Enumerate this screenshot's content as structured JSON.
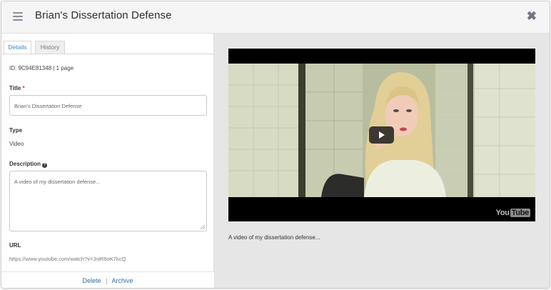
{
  "header": {
    "title": "Brian's Dissertation Defense",
    "menu_icon": "hamburger-icon",
    "close_icon": "close-icon",
    "close_glyph": "✖"
  },
  "tabs": [
    {
      "label": "Details",
      "active": true
    },
    {
      "label": "History",
      "active": false
    }
  ],
  "details": {
    "id_line": "ID: 9C94E81348 | 1 page",
    "title_label": "Title",
    "required_mark": "*",
    "title_value": "Brian's Dissertation Defense",
    "type_label": "Type",
    "type_value": "Video",
    "description_label": "Description",
    "help_icon": "help-icon",
    "help_glyph": "?",
    "description_value": "A video of my dissertation defense...",
    "url_label": "URL",
    "url_value": "https://www.youtube.com/watch?v=JniR6oK7kcQ"
  },
  "footer": {
    "delete_label": "Delete",
    "separator": "|",
    "archive_label": "Archive"
  },
  "preview": {
    "caption": "A video of my dissertation defense...",
    "play_icon": "play-icon",
    "logo_you": "You",
    "logo_tube": "Tube"
  },
  "colors": {
    "accent": "#3a8ac2",
    "link": "#2f6ea3",
    "required": "#d0312d",
    "header_bg": "#f5f5f5",
    "preview_bg": "#e6e6e6"
  }
}
